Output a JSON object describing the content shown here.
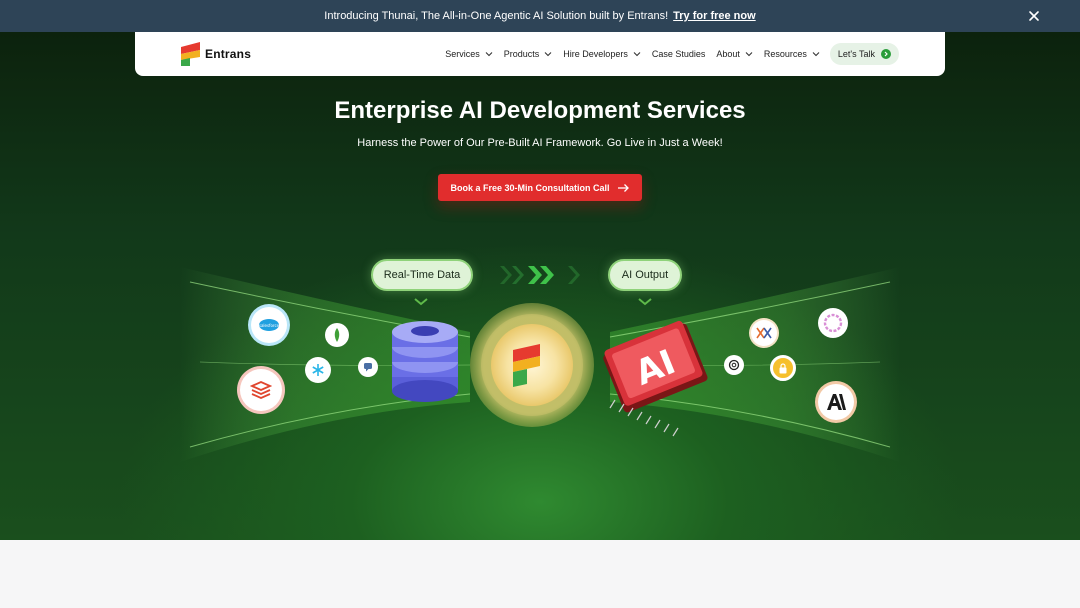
{
  "announcement": {
    "text": "Introducing Thunai, The All-in-One Agentic AI Solution built by Entrans!",
    "link": "Try for free now"
  },
  "nav": {
    "logo_text": "Entrans",
    "items": [
      {
        "label": "Services",
        "dropdown": true
      },
      {
        "label": "Products",
        "dropdown": true
      },
      {
        "label": "Hire Developers",
        "dropdown": true
      },
      {
        "label": "Case Studies",
        "dropdown": false
      },
      {
        "label": "About",
        "dropdown": true
      },
      {
        "label": "Resources",
        "dropdown": true
      }
    ],
    "cta": "Let's Talk"
  },
  "hero": {
    "title": "Enterprise AI Development Services",
    "subtitle": "Harness the Power of Our Pre-Built AI Framework. Go Live in Just a Week!",
    "cta": "Book a Free 30-Min Consultation Call"
  },
  "illustration": {
    "input_label": "Real-Time Data",
    "output_label": "AI Output",
    "chip_text": "AI",
    "icons_left": [
      "salesforce-icon",
      "mongodb-icon",
      "snowflake-icon",
      "chat-icon",
      "databricks-icon"
    ],
    "icons_right": [
      "perplexity-icon",
      "openai-icon",
      "lock-icon",
      "ring-icon",
      "anthropic-icon"
    ]
  },
  "colors": {
    "announce_bg": "#2e4457",
    "cta_red": "#e12d2d",
    "brand_green": "#2a9d3a"
  }
}
